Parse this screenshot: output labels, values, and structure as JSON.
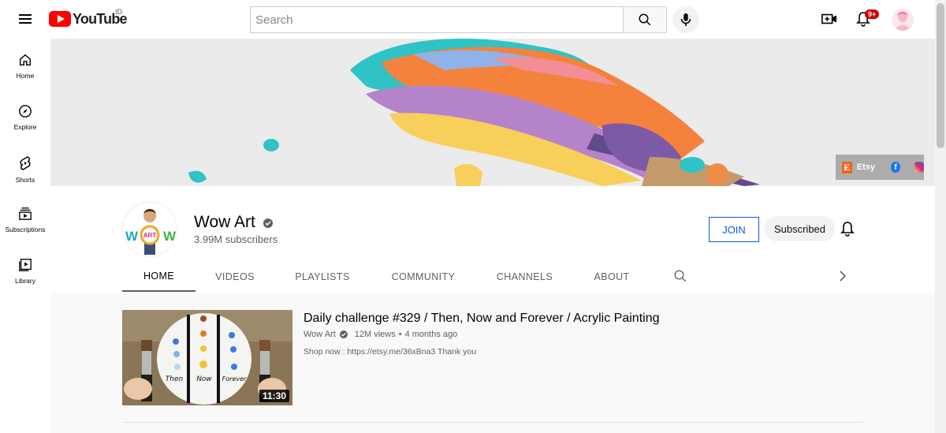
{
  "header": {
    "logo_text": "YouTube",
    "country_code": "ID",
    "search_placeholder": "Search",
    "notification_badge": "9+"
  },
  "sidebar": {
    "items": [
      {
        "label": "Home",
        "icon": "home-icon"
      },
      {
        "label": "Explore",
        "icon": "compass-icon"
      },
      {
        "label": "Shorts",
        "icon": "shorts-icon"
      },
      {
        "label": "Subscriptions",
        "icon": "subscriptions-icon"
      },
      {
        "label": "Library",
        "icon": "library-icon"
      }
    ]
  },
  "banner": {
    "links": {
      "etsy_label": "Etsy",
      "etsy_letter": "E",
      "facebook_letter": "f"
    }
  },
  "channel": {
    "name": "Wow Art",
    "subscribers": "3.99M subscribers",
    "avatar_text": "WOW",
    "avatar_badge": "ART",
    "join_label": "JOIN",
    "subscribed_label": "Subscribed",
    "tabs": [
      "HOME",
      "VIDEOS",
      "PLAYLISTS",
      "COMMUNITY",
      "CHANNELS",
      "ABOUT"
    ]
  },
  "featured_video": {
    "title": "Daily challenge #329 / Then, Now and Forever / Acrylic Painting",
    "channel": "Wow Art",
    "views": "12M views",
    "age": "4 months ago",
    "separator": "•",
    "description": "Shop now : https://etsy.me/36xBna3 Thank you",
    "duration": "11:30",
    "thumb_labels": [
      "Then",
      "Now",
      "Forever"
    ]
  },
  "colors": {
    "brand_red": "#ff0000",
    "join_blue": "#065fd4",
    "badge_red": "#cc0000"
  }
}
